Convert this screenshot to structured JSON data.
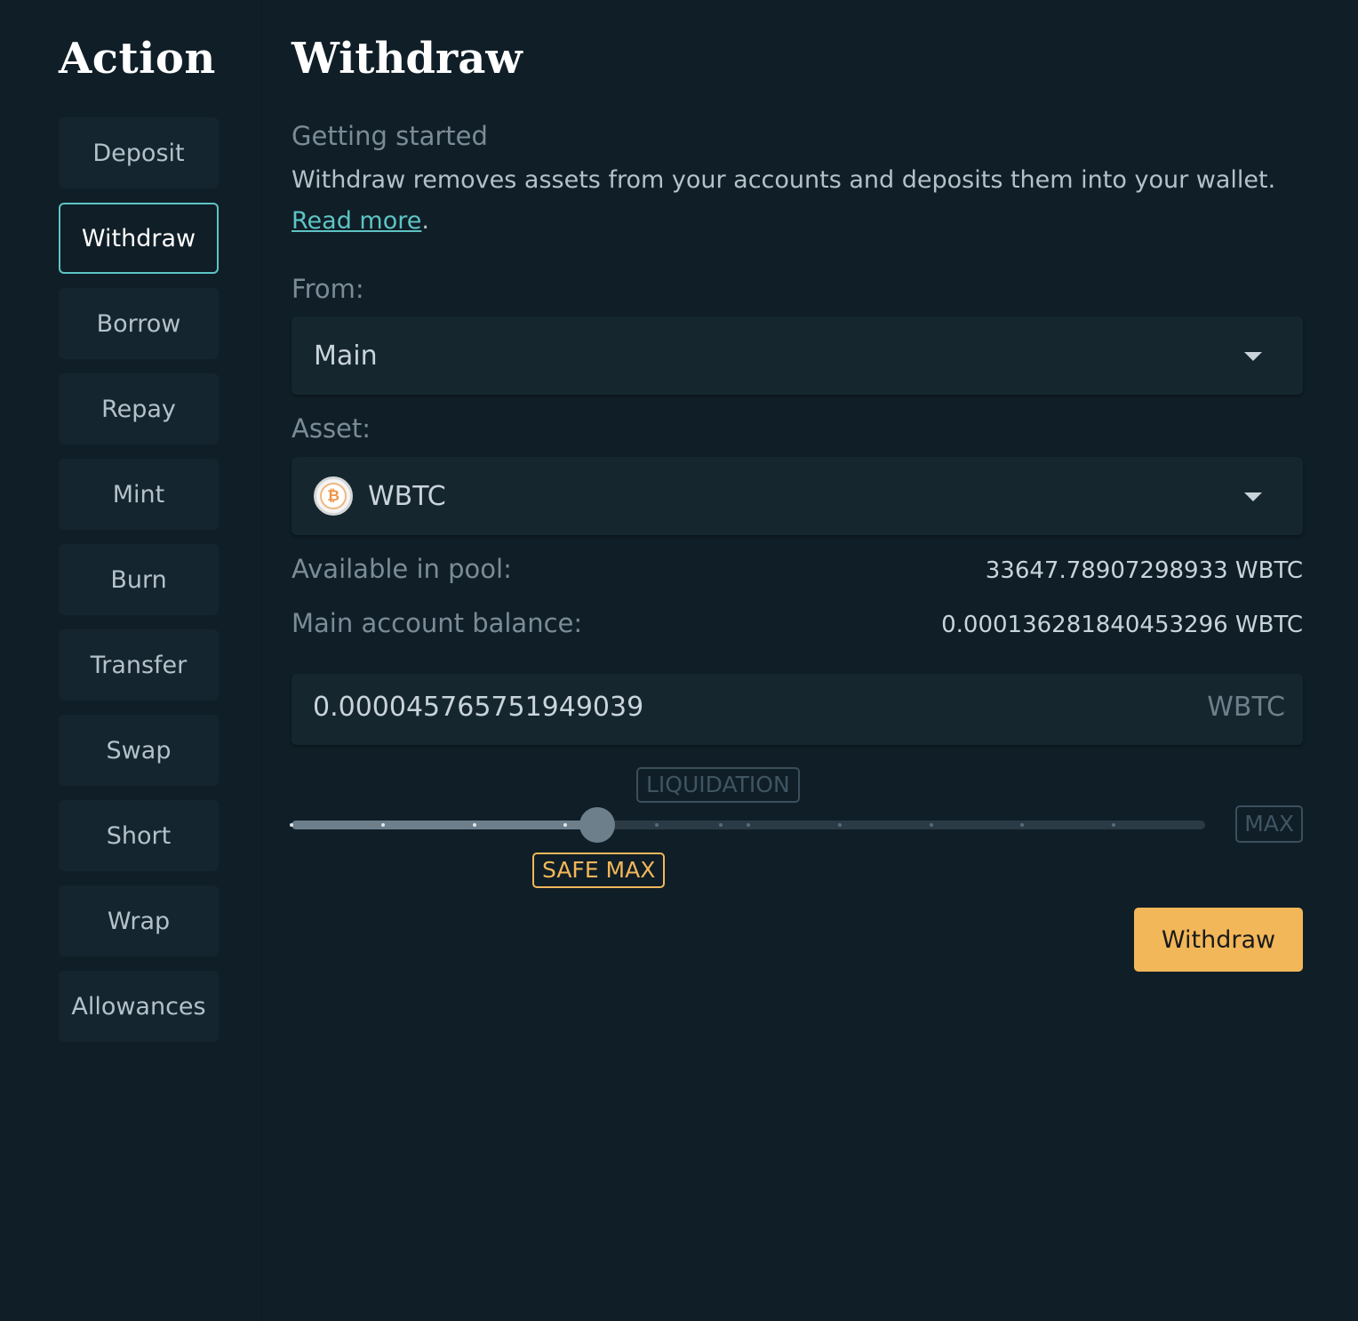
{
  "sidebar": {
    "title": "Action",
    "items": [
      {
        "label": "Deposit",
        "active": false
      },
      {
        "label": "Withdraw",
        "active": true
      },
      {
        "label": "Borrow",
        "active": false
      },
      {
        "label": "Repay",
        "active": false
      },
      {
        "label": "Mint",
        "active": false
      },
      {
        "label": "Burn",
        "active": false
      },
      {
        "label": "Transfer",
        "active": false
      },
      {
        "label": "Swap",
        "active": false
      },
      {
        "label": "Short",
        "active": false
      },
      {
        "label": "Wrap",
        "active": false
      },
      {
        "label": "Allowances",
        "active": false
      }
    ]
  },
  "main": {
    "title": "Withdraw",
    "intro": {
      "heading": "Getting started",
      "text": "Withdraw removes assets from your accounts and deposits them into your wallet. ",
      "link_text": "Read more",
      "suffix": "."
    },
    "from": {
      "label": "From:",
      "value": "Main"
    },
    "asset": {
      "label": "Asset:",
      "value": "WBTC",
      "icon": "bitcoin-icon"
    },
    "available": {
      "label": "Available in pool:",
      "value": "33647.78907298933 WBTC"
    },
    "balance": {
      "label": "Main account balance:",
      "value": "0.000136281840453296 WBTC"
    },
    "amount": {
      "value": "0.000045765751949039",
      "unit": "WBTC"
    },
    "slider": {
      "value_fraction": 0.335,
      "liquidation_label": "LIQUIDATION",
      "max_label": "MAX",
      "safe_max_label": "SAFE MAX"
    },
    "submit_label": "Withdraw"
  },
  "colors": {
    "accent": "#5ec4c4",
    "warning": "#f2b759",
    "background": "#101e27",
    "panel": "#15262f"
  }
}
